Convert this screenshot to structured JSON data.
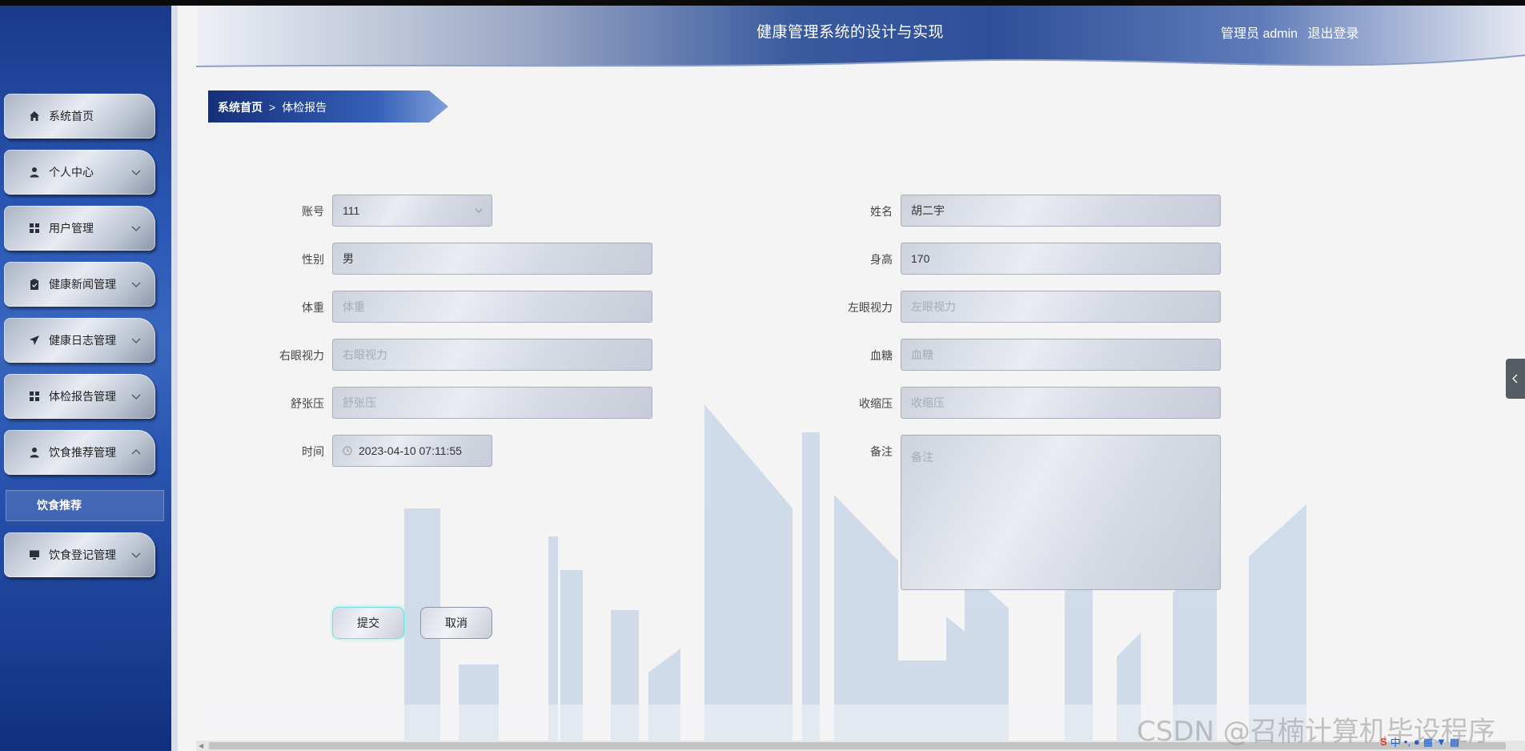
{
  "header": {
    "title": "健康管理系统的设计与实现",
    "user_label": "管理员 admin",
    "logout_label": "退出登录"
  },
  "breadcrumb": {
    "home": "系统首页",
    "separator": ">",
    "current": "体检报告"
  },
  "sidebar": {
    "items": [
      {
        "label": "系统首页",
        "icon": "home-icon"
      },
      {
        "label": "个人中心",
        "icon": "user-icon"
      },
      {
        "label": "用户管理",
        "icon": "grid-icon"
      },
      {
        "label": "健康新闻管理",
        "icon": "clipboard-icon"
      },
      {
        "label": "健康日志管理",
        "icon": "send-icon"
      },
      {
        "label": "体检报告管理",
        "icon": "grid-icon"
      },
      {
        "label": "饮食推荐管理",
        "icon": "user-icon"
      },
      {
        "label": "饮食登记管理",
        "icon": "monitor-icon"
      }
    ],
    "sub_item": "饮食推荐"
  },
  "form": {
    "account": {
      "label": "账号",
      "value": "111"
    },
    "name": {
      "label": "姓名",
      "value": "胡二宇"
    },
    "gender": {
      "label": "性别",
      "value": "男"
    },
    "height": {
      "label": "身高",
      "value": "170"
    },
    "weight": {
      "label": "体重",
      "placeholder": "体重"
    },
    "left_vision": {
      "label": "左眼视力",
      "placeholder": "左眼视力"
    },
    "right_vision": {
      "label": "右眼视力",
      "placeholder": "右眼视力"
    },
    "blood_sugar": {
      "label": "血糖",
      "placeholder": "血糖"
    },
    "diastolic": {
      "label": "舒张压",
      "placeholder": "舒张压"
    },
    "systolic": {
      "label": "收缩压",
      "placeholder": "收缩压"
    },
    "time": {
      "label": "时间",
      "value": "2023-04-10 07:11:55"
    },
    "remarks": {
      "label": "备注",
      "placeholder": "备注"
    }
  },
  "buttons": {
    "submit": "提交",
    "cancel": "取消"
  },
  "watermark": "CSDN @召楠计算机毕设程序",
  "colors": {
    "sidebar": "#2b58b6",
    "breadcrumb": "#1d3f8f",
    "accent_submit_border": "#6fe3dd"
  }
}
